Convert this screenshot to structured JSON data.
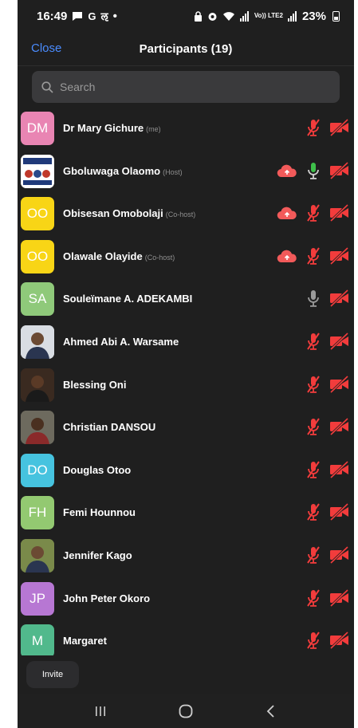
{
  "status_bar": {
    "time": "16:49",
    "icons_left": [
      "chat-icon",
      "google-icon",
      "vpn-icon"
    ],
    "dot": "•",
    "network_label": "Vo)) LTE2",
    "battery": "23%"
  },
  "header": {
    "close_label": "Close",
    "title": "Participants (19)"
  },
  "search": {
    "placeholder": "Search"
  },
  "participants": [
    {
      "initials": "DM",
      "name": "Dr Mary Gichure",
      "tag": "(me)",
      "avatar_color": "#e985b3",
      "photo": false,
      "mic": "muted",
      "cloud": false
    },
    {
      "initials": "",
      "name": "Gboluwaga Olaomo",
      "tag": "(Host)",
      "avatar_color": "#ffffff",
      "photo": true,
      "mic": "active",
      "cloud": true
    },
    {
      "initials": "OO",
      "name": "Obisesan Omobolaji",
      "tag": "(Co-host)",
      "avatar_color": "#f8d516",
      "photo": false,
      "mic": "muted",
      "cloud": true
    },
    {
      "initials": "OO",
      "name": "Olawale Olayide",
      "tag": "(Co-host)",
      "avatar_color": "#f8d516",
      "photo": false,
      "mic": "muted",
      "cloud": true
    },
    {
      "initials": "SA",
      "name": "Souleïmane A. ADEKAMBI",
      "tag": "",
      "avatar_color": "#8fc97a",
      "photo": false,
      "mic": "idle",
      "cloud": false
    },
    {
      "initials": "",
      "name": "Ahmed Abi A. Warsame",
      "tag": "",
      "avatar_color": "#d9dde3",
      "photo": true,
      "mic": "muted",
      "cloud": false
    },
    {
      "initials": "",
      "name": "Blessing Oni",
      "tag": "",
      "avatar_color": "#3a2a20",
      "photo": true,
      "mic": "muted",
      "cloud": false
    },
    {
      "initials": "",
      "name": "Christian DANSOU",
      "tag": "",
      "avatar_color": "#6d6a5e",
      "photo": true,
      "mic": "muted",
      "cloud": false
    },
    {
      "initials": "DO",
      "name": "Douglas Otoo",
      "tag": "",
      "avatar_color": "#46c3df",
      "photo": false,
      "mic": "muted",
      "cloud": false
    },
    {
      "initials": "FH",
      "name": "Femi Hounnou",
      "tag": "",
      "avatar_color": "#93c971",
      "photo": false,
      "mic": "muted",
      "cloud": false
    },
    {
      "initials": "",
      "name": "Jennifer Kago",
      "tag": "",
      "avatar_color": "#7a8a4a",
      "photo": true,
      "mic": "muted",
      "cloud": false
    },
    {
      "initials": "JP",
      "name": "John Peter Okoro",
      "tag": "",
      "avatar_color": "#b777d3",
      "photo": false,
      "mic": "muted",
      "cloud": false
    },
    {
      "initials": "M",
      "name": "Margaret",
      "tag": "",
      "avatar_color": "#51b98c",
      "photo": false,
      "mic": "muted",
      "cloud": false
    }
  ],
  "footer": {
    "invite_label": "Invite"
  },
  "colors": {
    "accent": "#4a8cff",
    "muted_red": "#f23c3c",
    "active_green": "#3ec04a",
    "idle_grey": "#9a9a9a",
    "cloud_red": "#f25a5a"
  }
}
